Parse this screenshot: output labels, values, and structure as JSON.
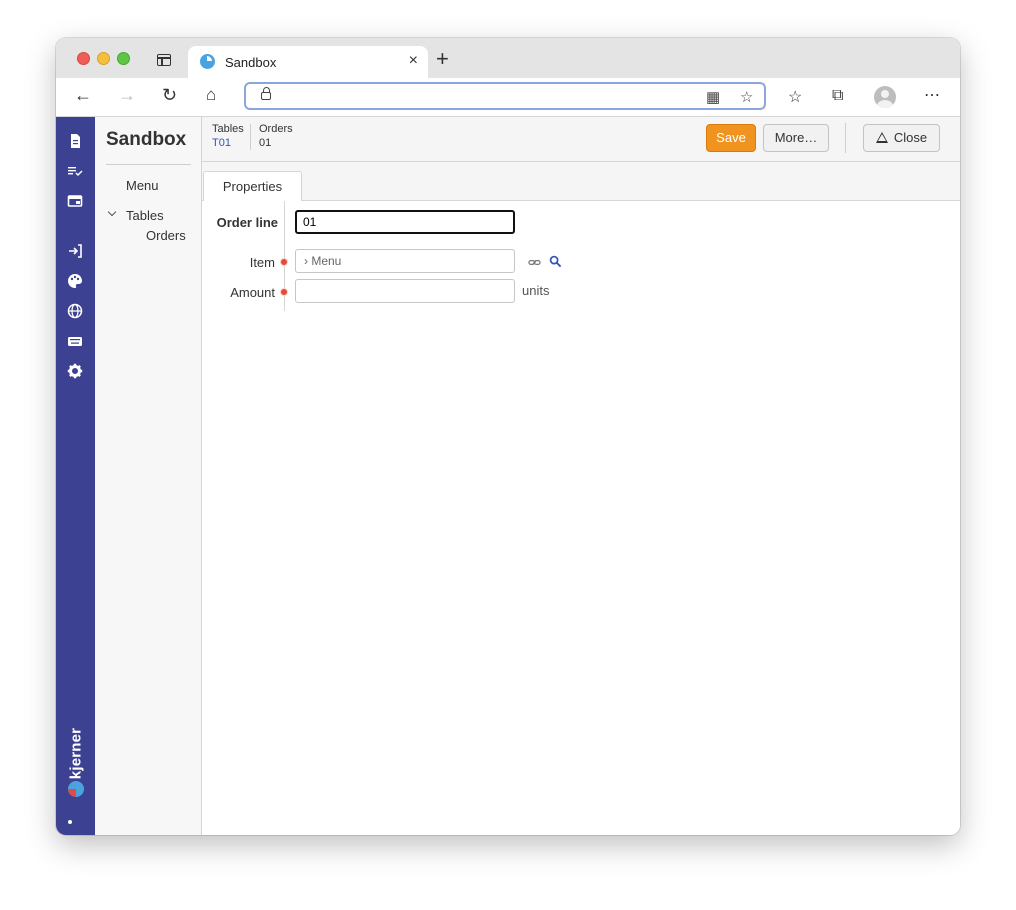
{
  "browser": {
    "tab_title": "Sandbox",
    "tab_close": "×",
    "new_tab": "+",
    "address": ""
  },
  "sidebar": {
    "title": "Sandbox",
    "items": [
      {
        "label": "Menu"
      },
      {
        "label": "Tables"
      },
      {
        "label": "Orders"
      }
    ]
  },
  "brand": {
    "name": "kjerner",
    "color": "#3d4192"
  },
  "header": {
    "breadcrumbs": [
      {
        "key": "Tables",
        "value": "T01"
      },
      {
        "key": "Orders",
        "value": "01"
      }
    ],
    "save_label": "Save",
    "more_label": "More…",
    "close_label": "Close"
  },
  "tabs": [
    {
      "label": "Properties"
    }
  ],
  "form": {
    "order_line": {
      "label": "Order line",
      "value": "01"
    },
    "item": {
      "label": "Item",
      "value": "› Menu"
    },
    "amount": {
      "label": "Amount",
      "value": "",
      "unit": "units"
    }
  },
  "colors": {
    "accent": "#f1941f",
    "rail": "#3d4192",
    "link": "#2f56b5",
    "required": "#e84a3a"
  }
}
